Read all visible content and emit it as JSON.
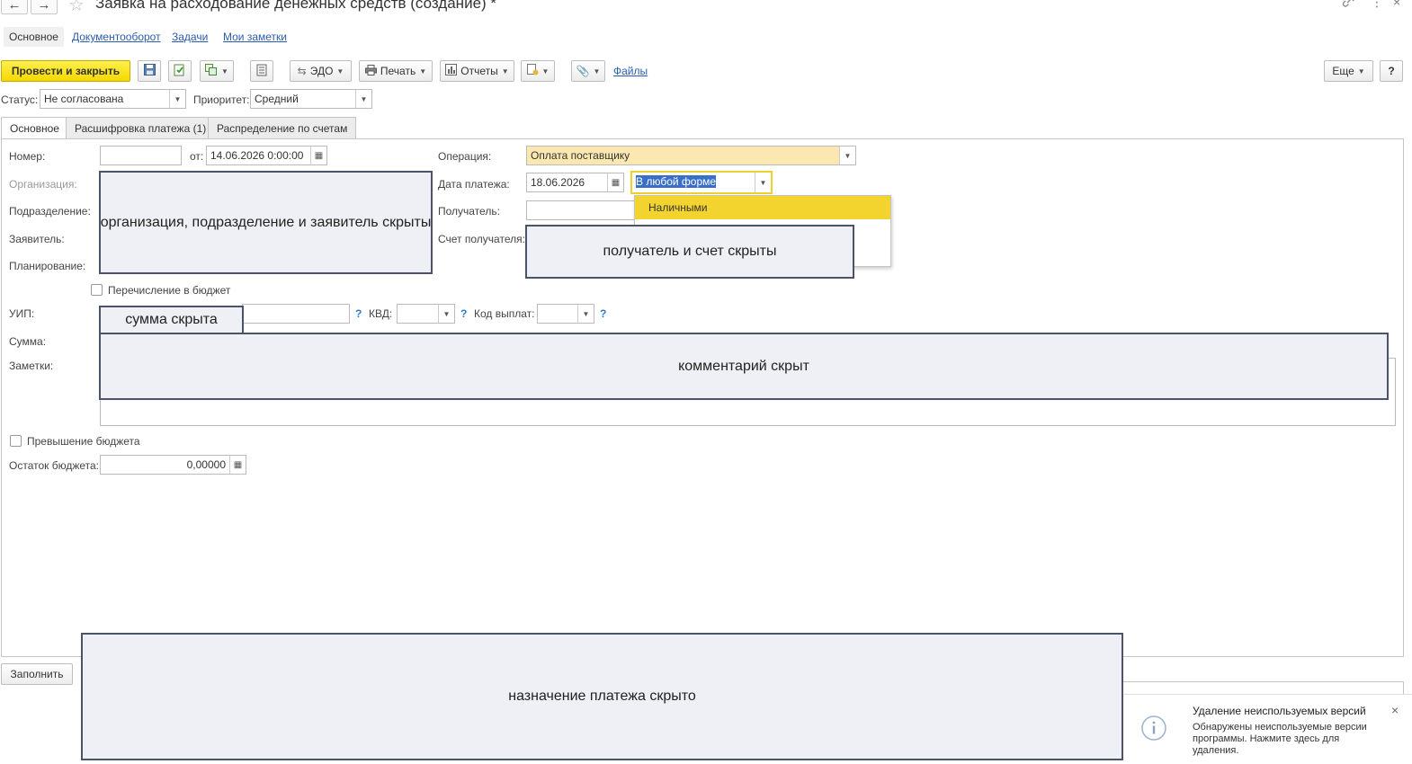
{
  "window": {
    "title": "Заявка на расходование денежных средств (создание) *",
    "back_icon": "←",
    "forward_icon": "→",
    "star_icon": "☆",
    "link_icon": "🔗",
    "menu_icon": "⋮",
    "close_icon": "×"
  },
  "section_tabs": [
    "Основное",
    "Документооборот",
    "Задачи",
    "Мои заметки"
  ],
  "toolbar": {
    "post_close": "Провести и закрыть",
    "edo": "ЭДО",
    "print": "Печать",
    "reports": "Отчеты",
    "files": "Файлы",
    "more": "Еще",
    "help": "?"
  },
  "status_row": {
    "status_label": "Статус:",
    "status_value": "Не согласована",
    "priority_label": "Приоритет:",
    "priority_value": "Средний"
  },
  "form_tabs": [
    "Основное",
    "Расшифровка платежа (1)",
    "Распределение по счетам"
  ],
  "form": {
    "number_label": "Номер:",
    "number_value": "",
    "from_label": "от:",
    "date_value": "14.06.2026  0:00:00",
    "org_label": "Организация:",
    "dept_label": "Подразделение:",
    "applicant_label": "Заявитель:",
    "planning_label": "Планирование:",
    "budget_transfer_label": "Перечисление в бюджет",
    "uip_label": "УИП:",
    "kvd_label": "КВД:",
    "payout_code_label": "Код выплат:",
    "sum_label": "Сумма:",
    "notes_label": "Заметки:",
    "operation_label": "Операция:",
    "operation_value": "Оплата поставщику",
    "payment_date_label": "Дата платежа:",
    "payment_date_value": "18.06.2026",
    "payment_form_value": "В любой форме",
    "recipient_label": "Получатель:",
    "recipient_account_label": "Счет получателя:",
    "budget_exceed_label": "Превышение бюджета",
    "budget_rest_label": "Остаток бюджета:",
    "budget_rest_value": "0,00000",
    "fill_button": "Заполнить"
  },
  "dropdown": {
    "options": [
      "Наличными"
    ]
  },
  "covers": {
    "org": "организация, подразделение и заявитель скрыты",
    "recipient": "получатель и счет скрыты",
    "sum": "сумма скрыта",
    "comment": "комментарий скрыт",
    "purpose": "назначение платежа скрыто"
  },
  "notification": {
    "title": "Удаление неиспользуемых версий",
    "text": "Обнаружены неиспользуемые версии программы. Нажмите здесь для удаления."
  },
  "colors": {
    "primary": "#f5d800",
    "highlight": "#f3d32e",
    "link": "#2a5db0",
    "operation_bg": "#fbe8b0"
  }
}
